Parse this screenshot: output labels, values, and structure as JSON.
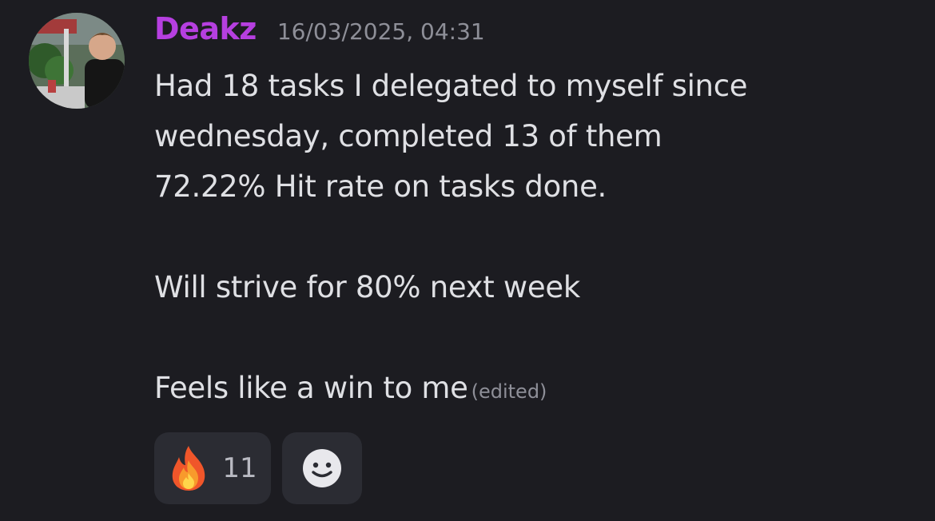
{
  "message": {
    "author": "Deakz",
    "author_color": "#b63fe0",
    "timestamp": "16/03/2025, 04:31",
    "lines": [
      "Had 18 tasks I delegated to myself since",
      "wednesday, completed 13 of them",
      "72.22% Hit rate on tasks done.",
      "",
      "Will strive for 80% next week",
      "",
      "Feels like a win to me"
    ],
    "edited_label": "(edited)"
  },
  "reactions": [
    {
      "icon": "fire-emoji-icon",
      "count": "11"
    },
    {
      "icon": "add-reaction-smiley-icon"
    }
  ]
}
